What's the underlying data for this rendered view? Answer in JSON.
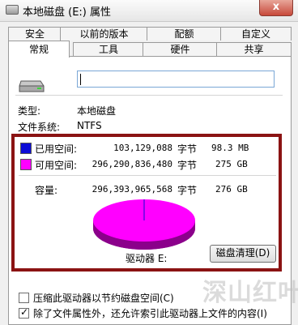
{
  "window": {
    "title": "本地磁盘 (E:) 属性",
    "close_label": "x"
  },
  "tabs": {
    "top_row": [
      "安全",
      "以前的版本",
      "配额",
      "自定义"
    ],
    "bottom_row": [
      "常规",
      "工具",
      "硬件",
      "共享"
    ],
    "active": "常规"
  },
  "general": {
    "name_value": "",
    "type_label": "类型:",
    "type_value": "本地磁盘",
    "fs_label": "文件系统:",
    "fs_value": "NTFS",
    "used": {
      "label": "已用空间:",
      "bytes": "103,129,088",
      "unit": "字节",
      "size": "98.3 MB",
      "color": "#0c0cd6"
    },
    "free": {
      "label": "可用空间:",
      "bytes": "296,290,836,480",
      "unit": "字节",
      "size": "275 GB",
      "color": "#ff00ff"
    },
    "capacity": {
      "label": "容量:",
      "bytes": "296,393,965,568",
      "unit": "字节",
      "size": "276 GB"
    },
    "drive_label": "驱动器 E:",
    "cleanup_label": "磁盘清理(D)",
    "compress_label": "压缩此驱动器以节约磁盘空间(C)",
    "compress_checked": false,
    "index_label": "除了文件属性外，还允许索引此驱动器上文件的内容(I)",
    "index_checked": true
  },
  "watermark": "深山红叶"
}
